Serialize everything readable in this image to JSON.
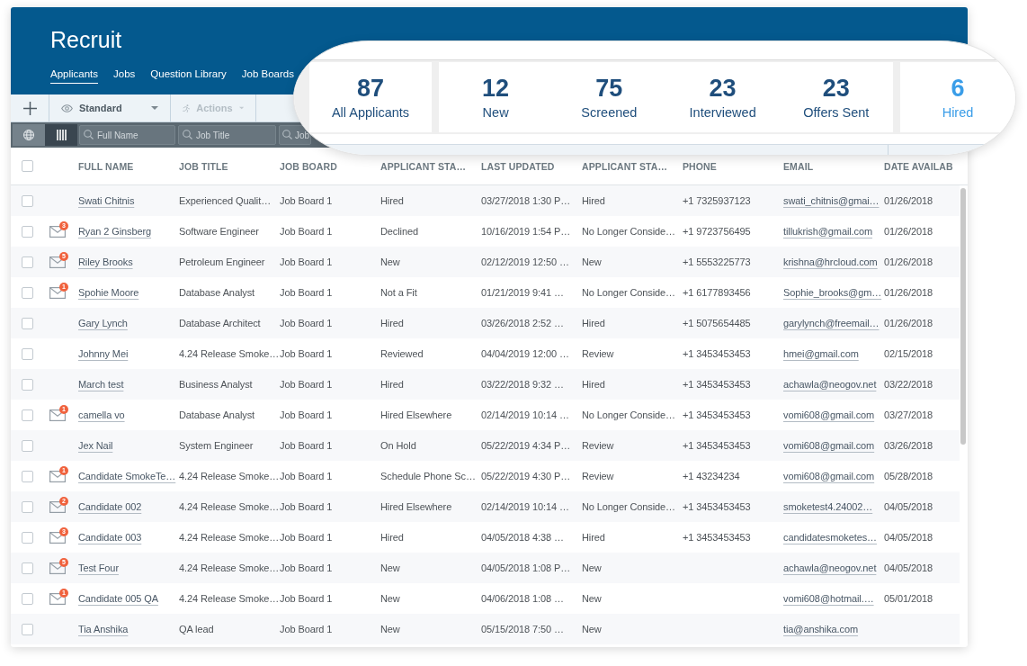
{
  "app": {
    "title": "Recruit"
  },
  "nav": {
    "tabs": [
      {
        "label": "Applicants",
        "selected": true
      },
      {
        "label": "Jobs",
        "selected": false
      },
      {
        "label": "Question Library",
        "selected": false
      },
      {
        "label": "Job Boards",
        "selected": false
      }
    ]
  },
  "summary": {
    "groups": [
      {
        "stats": [
          {
            "count": "87",
            "label": "All Applicants",
            "color": "#1f4e7c"
          }
        ]
      },
      {
        "stats": [
          {
            "count": "12",
            "label": "New",
            "color": "#1f4e7c"
          },
          {
            "count": "75",
            "label": "Screened",
            "color": "#1f4e7c"
          },
          {
            "count": "23",
            "label": "Interviewed",
            "color": "#1f4e7c"
          },
          {
            "count": "23",
            "label": "Offers Sent",
            "color": "#1f4e7c"
          }
        ]
      },
      {
        "stats": [
          {
            "count": "6",
            "label": "Hired",
            "color": "#3a9de8"
          }
        ]
      }
    ]
  },
  "toolbar": {
    "view": {
      "label": "Standard",
      "disabled": false
    },
    "actions": {
      "label": "Actions",
      "disabled": true
    }
  },
  "filter_bar": {
    "view_toggles": [
      {
        "kind": "globe",
        "selected": false
      },
      {
        "kind": "columns",
        "selected": true
      }
    ],
    "search_fields": [
      {
        "placeholder": "Full Name"
      },
      {
        "placeholder": "Job Title"
      },
      {
        "placeholder": "Job"
      }
    ]
  },
  "table": {
    "all_checked": false,
    "columns": [
      "FULL NAME",
      "JOB TITLE",
      "JOB BOARD",
      "APPLICANT STA…",
      "LAST UPDATED",
      "APPLICANT STA…",
      "PHONE",
      "EMAIL",
      "DATE AVAILAB"
    ],
    "rows": [
      {
        "checked": false,
        "full_name": "Swati Chitnis",
        "job_title": "Experienced Qualit…",
        "job_board": "Job Board 1",
        "column_4": "Hired",
        "last_updated": "03/27/2018 1:30 P…",
        "column_6": "Hired",
        "phone": "+1 7325937123",
        "email": "swati_chitnis@gmai…",
        "column_9": "01/26/2018"
      },
      {
        "checked": false,
        "messages": "3",
        "full_name": "Ryan 2 Ginsberg",
        "job_title": "Software Engineer",
        "job_board": "Job Board 1",
        "column_4": "Declined",
        "last_updated": "10/16/2019 1:54 P…",
        "column_6": "No Longer Conside…",
        "phone": "+1 9723756495",
        "email": "tillukrish@gmail.com",
        "column_9": "01/26/2018"
      },
      {
        "checked": false,
        "messages": "5",
        "full_name": "Riley Brooks",
        "job_title": "Petroleum Engineer",
        "job_board": "Job Board 1",
        "column_4": "New",
        "last_updated": "02/12/2019 12:50 …",
        "column_6": "New",
        "phone": "+1 5553225773",
        "email": "krishna@hrcloud.com",
        "column_9": "01/26/2018"
      },
      {
        "checked": false,
        "messages": "1",
        "full_name": "Spohie Moore",
        "job_title": "Database Analyst",
        "job_board": "Job Board 1",
        "column_4": "Not a Fit",
        "last_updated": "01/21/2019 9:41 …",
        "column_6": "No Longer Conside…",
        "phone": "+1 6177893456",
        "email": "Sophie_brooks@gm…",
        "column_9": "01/26/2018"
      },
      {
        "checked": false,
        "full_name": "Gary Lynch",
        "job_title": "Database Architect",
        "job_board": "Job Board 1",
        "column_4": "Hired",
        "last_updated": "03/26/2018 2:52 …",
        "column_6": "Hired",
        "phone": "+1 5075654485",
        "email": "garylynch@freemail…",
        "column_9": "01/26/2018"
      },
      {
        "checked": false,
        "full_name": "Johnny Mei",
        "job_title": "4.24 Release Smoke…",
        "job_board": "Job Board 1",
        "column_4": "Reviewed",
        "last_updated": "04/04/2019 12:00 …",
        "column_6": "Review",
        "phone": "+1 3453453453",
        "email": "hmei@gmail.com",
        "column_9": "02/15/2018"
      },
      {
        "checked": false,
        "full_name": "March test",
        "job_title": "Business Analyst",
        "job_board": "Job Board 1",
        "column_4": "Hired",
        "last_updated": "03/22/2018 9:32 …",
        "column_6": "Hired",
        "phone": "+1 3453453453",
        "email": "achawla@neogov.net",
        "column_9": "03/22/2018"
      },
      {
        "checked": false,
        "messages": "1",
        "full_name": "camella vo",
        "job_title": "Database Analyst",
        "job_board": "Job Board 1",
        "column_4": "Hired Elsewhere",
        "last_updated": "02/14/2019 10:14 …",
        "column_6": "No Longer Conside…",
        "phone": "+1 3453453453",
        "email": "vomi608@gmail.com",
        "column_9": "03/27/2018"
      },
      {
        "checked": false,
        "full_name": "Jex Nail",
        "job_title": "System Engineer",
        "job_board": "Job Board 1",
        "column_4": "On Hold",
        "last_updated": "05/22/2019 4:34 P…",
        "column_6": "Review",
        "phone": "+1 3453453453",
        "email": "vomi608@gmail.com",
        "column_9": "03/26/2018"
      },
      {
        "checked": false,
        "messages": "1",
        "full_name": "Candidate SmokeTe…",
        "job_title": "4.24 Release Smoke…",
        "job_board": "Job Board 1",
        "column_4": "Schedule Phone Sc…",
        "last_updated": "05/22/2019 4:30 P…",
        "column_6": "Review",
        "phone": "+1 43234234",
        "email": "vomi608@gmail.com",
        "column_9": "05/28/2018"
      },
      {
        "checked": false,
        "messages": "2",
        "full_name": "Candidate 002",
        "job_title": "4.24 Release Smoke…",
        "job_board": "Job Board 1",
        "column_4": "Hired Elsewhere",
        "last_updated": "02/14/2019 10:14 …",
        "column_6": "No Longer Conside…",
        "phone": "+1 3453453453",
        "email": "smoketest4.24002…",
        "column_9": "04/05/2018"
      },
      {
        "checked": false,
        "messages": "3",
        "full_name": "Candidate 003",
        "job_title": "4.24 Release Smoke…",
        "job_board": "Job Board 1",
        "column_4": "Hired",
        "last_updated": "04/05/2018 4:38 …",
        "column_6": "Hired",
        "phone": "+1 3453453453",
        "email": "candidatesmoketes…",
        "column_9": "04/05/2018"
      },
      {
        "checked": false,
        "messages": "5",
        "full_name": "Test Four",
        "job_title": "4.24 Release Smoke…",
        "job_board": "Job Board 1",
        "column_4": "New",
        "last_updated": "04/05/2018 1:08 P…",
        "column_6": "New",
        "email": "achawla@neogov.net",
        "column_9": "04/05/2018"
      },
      {
        "checked": false,
        "messages": "1",
        "full_name": "Candidate 005 QA",
        "job_title": "4.24 Release Smoke…",
        "job_board": "Job Board 1",
        "column_4": "New",
        "last_updated": "04/06/2018 1:08 …",
        "column_6": "New",
        "email": "vomi608@hotmail.…",
        "column_9": "05/01/2018"
      },
      {
        "checked": false,
        "full_name": "Tia Anshika",
        "job_title": "QA lead",
        "job_board": "Job Board 1",
        "column_4": "New",
        "last_updated": "05/15/2018 7:50 …",
        "column_6": "New",
        "email": "tia@anshika.com"
      }
    ]
  }
}
